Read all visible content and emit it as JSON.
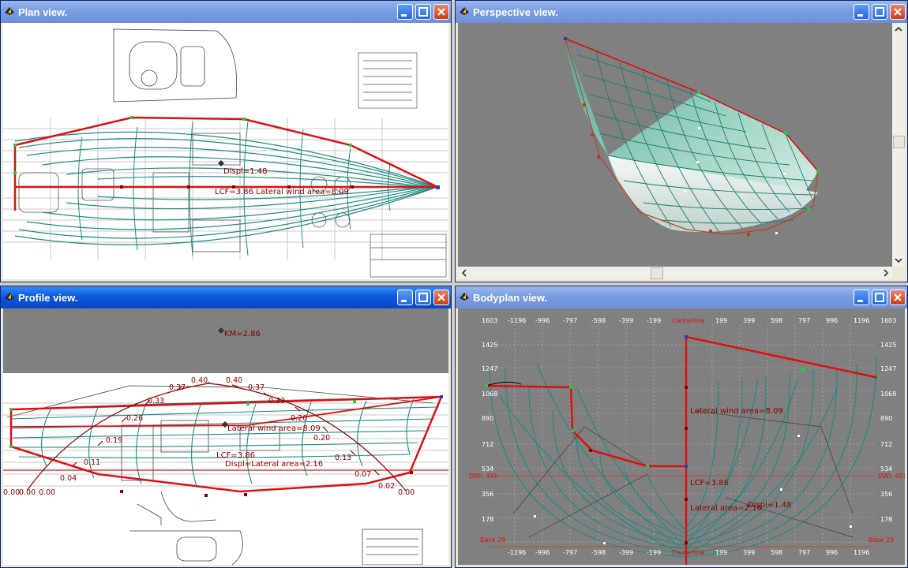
{
  "windows": {
    "plan": {
      "title": "Plan view."
    },
    "perspective": {
      "title": "Perspective view."
    },
    "profile": {
      "title": "Profile view."
    },
    "bodyplan": {
      "title": "Bodyplan view."
    }
  },
  "plan": {
    "displ": "Displ=1.48",
    "overlap": "LCF=3.86 Lateral wind area=8.09"
  },
  "profile": {
    "km": "KM=2.86",
    "wind": "Lateral wind area=8.09",
    "lcf": "LCF=3.86",
    "displ": "Displ=Lateral area=2.16",
    "left_zeros": [
      "0.00",
      "0.00",
      "0.00"
    ],
    "right_zero": "0.00",
    "curve_values": [
      "0.04",
      "0.11",
      "0.19",
      "0.26",
      "0.33",
      "0.37",
      "0.40",
      "0.40",
      "0.37",
      "0.33",
      "0.26",
      "0.20",
      "0.13",
      "0.07",
      "0.02"
    ]
  },
  "bodyplan": {
    "top_ticks": [
      "-1196",
      "-996",
      "-797",
      "-598",
      "-399",
      "-199",
      "Centerline",
      "199",
      "399",
      "598",
      "797",
      "996",
      "1196"
    ],
    "bottom_ticks": [
      "-1196",
      "-996",
      "-797",
      "-598",
      "-399",
      "-199",
      "Centerline",
      "199",
      "399",
      "598",
      "797",
      "996",
      "1196"
    ],
    "left_ticks": [
      "1603",
      "1425",
      "1247",
      "1068",
      "890",
      "712",
      "534",
      "356",
      "178"
    ],
    "right_ticks": [
      "1603",
      "1425",
      "1247",
      "1068",
      "890",
      "712",
      "534",
      "356",
      "178"
    ],
    "dwl_left": "DWL 491",
    "dwl_right": "DWL 491",
    "base_left": "Base 29",
    "base_right": "Base 29",
    "wind": "Lateral wind area=8.09",
    "lcf": "LCF=3.86",
    "lat": "Lateral area=2.16",
    "displ": "Displ=1.48"
  },
  "colors": {
    "mesh": "#1e8c82",
    "edge": "#e01010",
    "label": "#8b0000",
    "grey": "#808080"
  }
}
